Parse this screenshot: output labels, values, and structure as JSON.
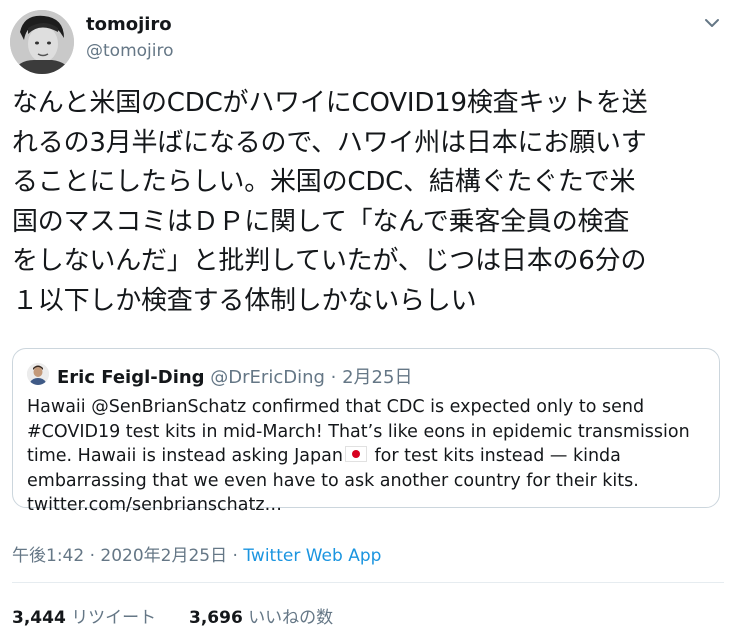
{
  "author": {
    "name": "tomojiro",
    "handle": "@tomojiro"
  },
  "tweet": {
    "text": "なんと米国のCDCがハワイにCOVID19検査キットを送\nれるの3月半ばになるので、ハワイ州は日本にお願いす\nることにしたらしい。米国のCDC、結構ぐたぐたで米\n国のマスコミはＤＰに関して「なんで乗客全員の検査\nをしないんだ」と批判していたが、じつは日本の6分の\n１以下しか検査する体制しかないらしい"
  },
  "quote": {
    "name": "Eric Feigl-Ding",
    "handle": "@DrEricDing",
    "separator": " · ",
    "date": "2月25日",
    "text_part1": "Hawaii @SenBrianSchatz confirmed that CDC is expected only to send #COVID19 test kits in mid-March! That’s like eons in epidemic transmission time. Hawaii is instead asking Japan",
    "flag_icon": "japan-flag-icon",
    "text_part2": " for test kits instead — kinda embarrassing that we even have to ask another country for their kits. twitter.com/senbrianschatz…"
  },
  "meta": {
    "time": "午後1:42",
    "sep1": " · ",
    "date": "2020年2月25日",
    "sep2": " · ",
    "source": "Twitter Web App"
  },
  "stats": {
    "retweets_count": "3,444",
    "retweets_label": "リツイート",
    "likes_count": "3,696",
    "likes_label": "いいねの数"
  },
  "colors": {
    "text": "#14171a",
    "secondary": "#657786",
    "link": "#1b95e0",
    "border": "#ccd6dd",
    "flag_red": "#d7001f"
  }
}
